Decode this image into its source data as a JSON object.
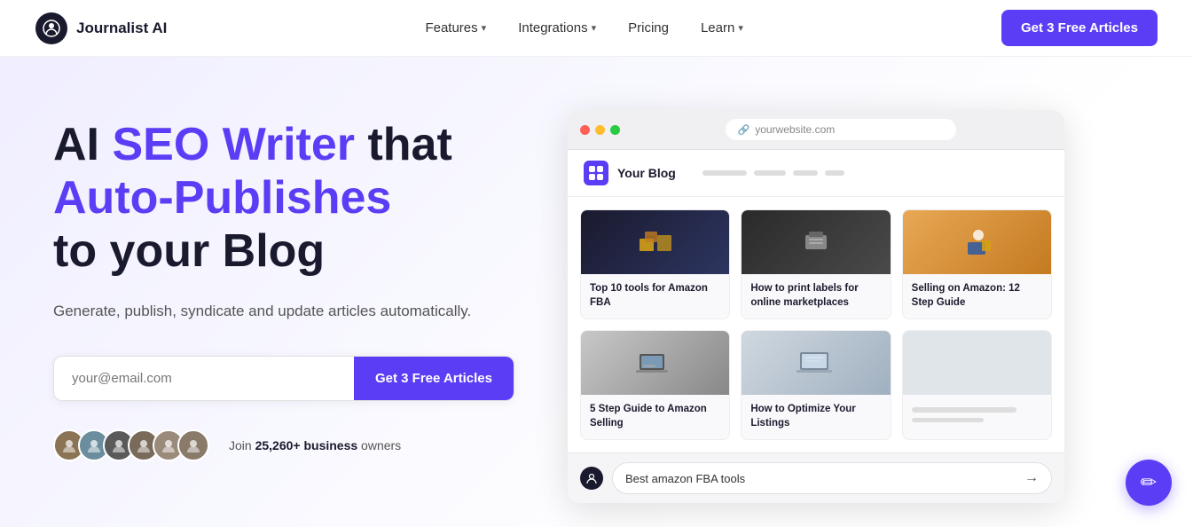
{
  "nav": {
    "logo_text": "Journalist AI",
    "links": [
      {
        "label": "Features",
        "has_dropdown": true
      },
      {
        "label": "Integrations",
        "has_dropdown": true
      },
      {
        "label": "Pricing",
        "has_dropdown": false
      },
      {
        "label": "Learn",
        "has_dropdown": true
      }
    ],
    "cta_label": "Get 3 Free Articles"
  },
  "hero": {
    "headline_part1": "AI ",
    "headline_purple": "SEO Writer",
    "headline_part2": " that",
    "headline_line2": "Auto-Publishes",
    "headline_line3": "to your Blog",
    "subtext": "Generate, publish, syndicate and update articles automatically.",
    "email_placeholder": "your@email.com",
    "cta_label": "Get 3 Free Articles",
    "social_text_pre": "Join ",
    "social_bold": "25,260+ business",
    "social_text_post": " owners"
  },
  "browser": {
    "url": "yourwebsite.com",
    "blog_title": "Your Blog",
    "blog_cards": [
      {
        "title": "Top 10 tools for Amazon FBA",
        "image_type": "amazon-boxes"
      },
      {
        "title": "How to print labels for online marketplaces",
        "image_type": "printer"
      },
      {
        "title": "Selling on Amazon: 12 Step Guide",
        "image_type": "delivery"
      },
      {
        "title": "5 Step Guide to Amazon Selling",
        "image_type": "laptop"
      },
      {
        "title": "How to Optimize Your Listings",
        "image_type": "laptop2"
      },
      {
        "title": "",
        "image_type": "placeholder"
      }
    ],
    "search_query": "Best amazon FBA tools"
  },
  "chat_icon": "✏"
}
